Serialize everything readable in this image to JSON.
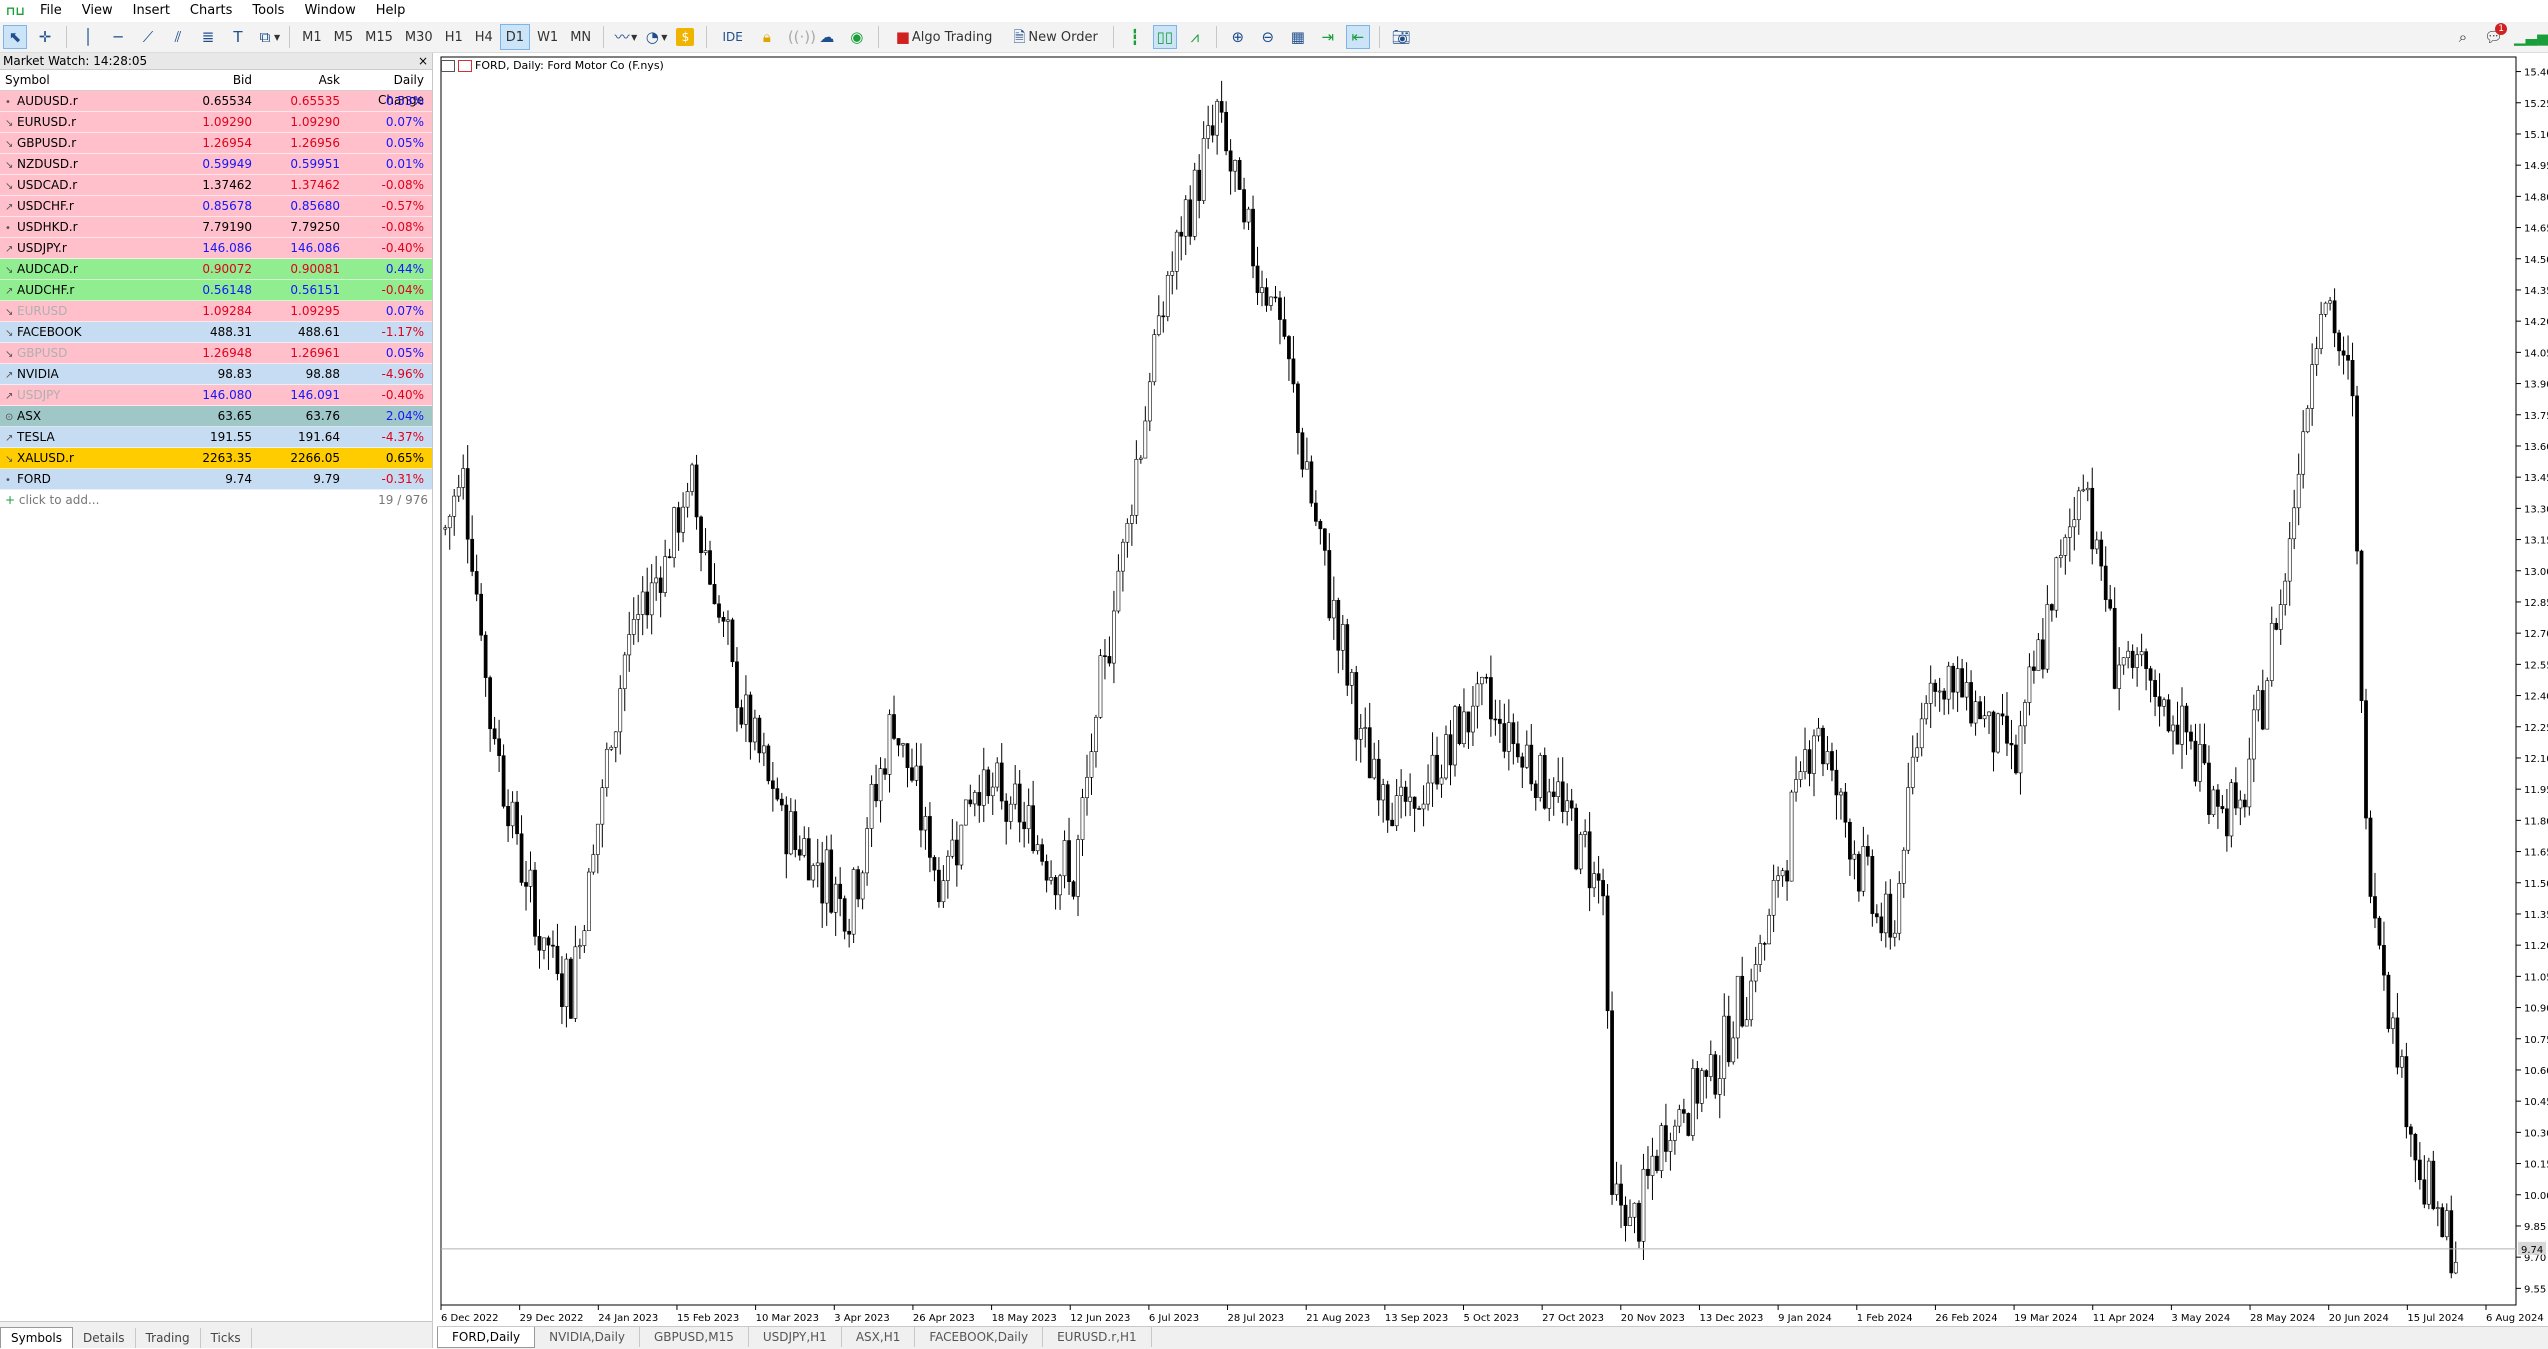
{
  "menu": [
    "File",
    "View",
    "Insert",
    "Charts",
    "Tools",
    "Window",
    "Help"
  ],
  "toolbar": {
    "timeframes": [
      "M1",
      "M5",
      "M15",
      "M30",
      "H1",
      "H4",
      "D1",
      "W1",
      "MN"
    ],
    "selected_timeframe": "D1",
    "ide_label": "IDE",
    "algo_trading_label": "Algo Trading",
    "new_order_label": "New Order",
    "notification_count": "1"
  },
  "market_watch": {
    "title": "Market Watch: 14:28:05",
    "columns": [
      "Symbol",
      "Bid",
      "Ask",
      "Daily Change"
    ],
    "rows": [
      {
        "symbol": "AUDUSD.r",
        "bid": "0.65534",
        "ask": "0.65535",
        "change": "0.53%",
        "bg": "#ffc0cb",
        "bidc": "#000000",
        "askc": "#e0001b",
        "chc": "#1515ff",
        "arrow": "•"
      },
      {
        "symbol": "EURUSD.r",
        "bid": "1.09290",
        "ask": "1.09290",
        "change": "0.07%",
        "bg": "#ffc0cb",
        "bidc": "#e0001b",
        "askc": "#e0001b",
        "chc": "#1515ff",
        "arrow": "↘"
      },
      {
        "symbol": "GBPUSD.r",
        "bid": "1.26954",
        "ask": "1.26956",
        "change": "0.05%",
        "bg": "#ffc0cb",
        "bidc": "#e0001b",
        "askc": "#e0001b",
        "chc": "#1515ff",
        "arrow": "↘"
      },
      {
        "symbol": "NZDUSD.r",
        "bid": "0.59949",
        "ask": "0.59951",
        "change": "0.01%",
        "bg": "#ffc0cb",
        "bidc": "#1515ff",
        "askc": "#1515ff",
        "chc": "#1515ff",
        "arrow": "↘"
      },
      {
        "symbol": "USDCAD.r",
        "bid": "1.37462",
        "ask": "1.37462",
        "change": "-0.08%",
        "bg": "#ffc0cb",
        "bidc": "#000000",
        "askc": "#e0001b",
        "chc": "#e0001b",
        "arrow": "↘"
      },
      {
        "symbol": "USDCHF.r",
        "bid": "0.85678",
        "ask": "0.85680",
        "change": "-0.57%",
        "bg": "#ffc0cb",
        "bidc": "#1515ff",
        "askc": "#1515ff",
        "chc": "#e0001b",
        "arrow": "↗"
      },
      {
        "symbol": "USDHKD.r",
        "bid": "7.79190",
        "ask": "7.79250",
        "change": "-0.08%",
        "bg": "#ffc0cb",
        "bidc": "#000000",
        "askc": "#000000",
        "chc": "#e0001b",
        "arrow": "•"
      },
      {
        "symbol": "USDJPY.r",
        "bid": "146.086",
        "ask": "146.086",
        "change": "-0.40%",
        "bg": "#ffc0cb",
        "bidc": "#1515ff",
        "askc": "#1515ff",
        "chc": "#e0001b",
        "arrow": "↗"
      },
      {
        "symbol": "AUDCAD.r",
        "bid": "0.90072",
        "ask": "0.90081",
        "change": "0.44%",
        "bg": "#90ee90",
        "bidc": "#e0001b",
        "askc": "#e0001b",
        "chc": "#1515ff",
        "arrow": "↘"
      },
      {
        "symbol": "AUDCHF.r",
        "bid": "0.56148",
        "ask": "0.56151",
        "change": "-0.04%",
        "bg": "#90ee90",
        "bidc": "#1515ff",
        "askc": "#1515ff",
        "chc": "#e0001b",
        "arrow": "↗"
      },
      {
        "symbol": "EURUSD",
        "bid": "1.09284",
        "ask": "1.09295",
        "change": "0.07%",
        "bg": "#ffc0cb",
        "bidc": "#e0001b",
        "askc": "#e0001b",
        "chc": "#1515ff",
        "arrow": "↘",
        "dim": true
      },
      {
        "symbol": "FACEBOOK",
        "bid": "488.31",
        "ask": "488.61",
        "change": "-1.17%",
        "bg": "#c6dcf2",
        "bidc": "#000000",
        "askc": "#000000",
        "chc": "#e0001b",
        "arrow": "↘"
      },
      {
        "symbol": "GBPUSD",
        "bid": "1.26948",
        "ask": "1.26961",
        "change": "0.05%",
        "bg": "#ffc0cb",
        "bidc": "#e0001b",
        "askc": "#e0001b",
        "chc": "#1515ff",
        "arrow": "↘",
        "dim": true
      },
      {
        "symbol": "NVIDIA",
        "bid": "98.83",
        "ask": "98.88",
        "change": "-4.96%",
        "bg": "#c6dcf2",
        "bidc": "#000000",
        "askc": "#000000",
        "chc": "#e0001b",
        "arrow": "↗"
      },
      {
        "symbol": "USDJPY",
        "bid": "146.080",
        "ask": "146.091",
        "change": "-0.40%",
        "bg": "#ffc0cb",
        "bidc": "#1515ff",
        "askc": "#1515ff",
        "chc": "#e0001b",
        "arrow": "↗",
        "dim": true
      },
      {
        "symbol": "ASX",
        "bid": "63.65",
        "ask": "63.76",
        "change": "2.04%",
        "bg": "#9fc7c7",
        "bidc": "#000000",
        "askc": "#000000",
        "chc": "#1515ff",
        "arrow": "⊙"
      },
      {
        "symbol": "TESLA",
        "bid": "191.55",
        "ask": "191.64",
        "change": "-4.37%",
        "bg": "#c6dcf2",
        "bidc": "#000000",
        "askc": "#000000",
        "chc": "#e0001b",
        "arrow": "↗"
      },
      {
        "symbol": "XALUSD.r",
        "bid": "2263.35",
        "ask": "2266.05",
        "change": "0.65%",
        "bg": "#ffcc00",
        "bidc": "#000000",
        "askc": "#000000",
        "chc": "#000000",
        "arrow": "↘"
      },
      {
        "symbol": "FORD",
        "bid": "9.74",
        "ask": "9.79",
        "change": "-0.31%",
        "bg": "#c6dcf2",
        "bidc": "#000000",
        "askc": "#000000",
        "chc": "#e0001b",
        "arrow": "•"
      }
    ],
    "add_label": "click to add...",
    "count": "19 / 976",
    "tabs": [
      "Symbols",
      "Details",
      "Trading",
      "Ticks"
    ]
  },
  "chart": {
    "header": "FORD, Daily:  Ford Motor Co (F.nys)",
    "tabs": [
      "FORD,Daily",
      "NVIDIA,Daily",
      "GBPUSD,M15",
      "USDJPY,H1",
      "ASX,H1",
      "FACEBOOK,Daily",
      "EURUSD.r,H1"
    ]
  },
  "chart_data": {
    "type": "bar",
    "title": "FORD, Daily:  Ford Motor Co (F.nys)",
    "y_ticks": [
      "15.40",
      "15.25",
      "15.10",
      "14.95",
      "14.80",
      "14.65",
      "14.50",
      "14.35",
      "14.20",
      "14.05",
      "13.90",
      "13.75",
      "13.60",
      "13.45",
      "13.30",
      "13.15",
      "13.00",
      "12.85",
      "12.70",
      "12.55",
      "12.40",
      "12.25",
      "12.10",
      "11.95",
      "11.80",
      "11.65",
      "11.50",
      "11.35",
      "11.20",
      "11.05",
      "10.90",
      "10.75",
      "10.60",
      "10.45",
      "10.30",
      "10.15",
      "10.00",
      "9.85",
      "9.70",
      "9.55"
    ],
    "ylim": [
      9.47,
      15.47
    ],
    "x_ticks": [
      "6 Dec 2022",
      "29 Dec 2022",
      "24 Jan 2023",
      "15 Feb 2023",
      "10 Mar 2023",
      "3 Apr 2023",
      "26 Apr 2023",
      "18 May 2023",
      "12 Jun 2023",
      "6 Jul 2023",
      "28 Jul 2023",
      "21 Aug 2023",
      "13 Sep 2023",
      "5 Oct 2023",
      "27 Oct 2023",
      "20 Nov 2023",
      "13 Dec 2023",
      "9 Jan 2024",
      "1 Feb 2024",
      "26 Feb 2024",
      "19 Mar 2024",
      "11 Apr 2024",
      "3 May 2024",
      "28 May 2024",
      "20 Jun 2024",
      "15 Jul 2024",
      "6 Aug 2024"
    ],
    "current_price": "9.74",
    "anchors": [
      [
        0,
        13.2
      ],
      [
        4,
        13.5
      ],
      [
        10,
        12.3
      ],
      [
        20,
        11.3
      ],
      [
        28,
        11.0
      ],
      [
        40,
        12.6
      ],
      [
        55,
        13.4
      ],
      [
        65,
        12.4
      ],
      [
        75,
        11.8
      ],
      [
        90,
        11.4
      ],
      [
        100,
        12.3
      ],
      [
        110,
        11.5
      ],
      [
        118,
        12.0
      ],
      [
        128,
        11.8
      ],
      [
        140,
        11.5
      ],
      [
        150,
        13.0
      ],
      [
        160,
        14.3
      ],
      [
        172,
        15.2
      ],
      [
        180,
        14.5
      ],
      [
        185,
        14.3
      ],
      [
        195,
        13.1
      ],
      [
        205,
        12.1
      ],
      [
        215,
        11.8
      ],
      [
        230,
        12.4
      ],
      [
        245,
        12.0
      ],
      [
        258,
        11.5
      ],
      [
        260,
        10.0
      ],
      [
        265,
        9.85
      ],
      [
        272,
        10.3
      ],
      [
        285,
        10.7
      ],
      [
        295,
        11.3
      ],
      [
        305,
        12.3
      ],
      [
        315,
        11.6
      ],
      [
        322,
        11.2
      ],
      [
        330,
        12.5
      ],
      [
        340,
        12.4
      ],
      [
        350,
        12.1
      ],
      [
        365,
        13.5
      ],
      [
        372,
        12.6
      ],
      [
        385,
        12.3
      ],
      [
        395,
        11.9
      ],
      [
        400,
        11.8
      ],
      [
        410,
        13.0
      ],
      [
        418,
        14.4
      ],
      [
        425,
        13.8
      ],
      [
        428,
        11.7
      ],
      [
        435,
        10.7
      ],
      [
        440,
        10.1
      ],
      [
        448,
        9.68
      ]
    ]
  }
}
